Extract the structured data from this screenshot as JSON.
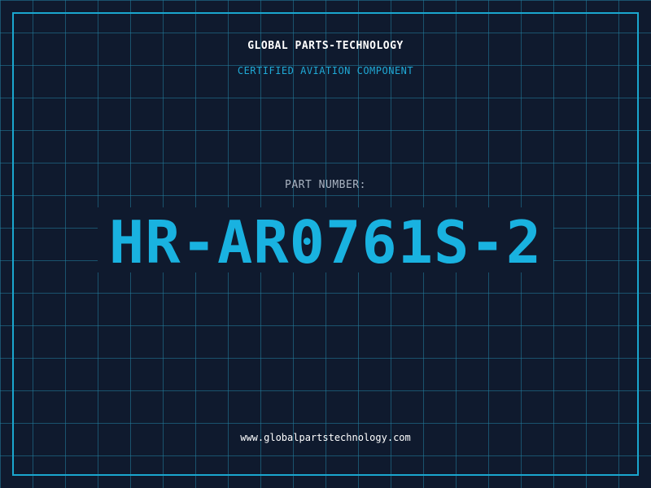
{
  "header": {
    "company_name": "GLOBAL PARTS-TECHNOLOGY",
    "subtitle": "CERTIFIED AVIATION COMPONENT"
  },
  "part": {
    "label": "PART NUMBER:",
    "number": "HR-AR0761S-2"
  },
  "footer": {
    "website": "www.globalpartstechnology.com"
  },
  "colors": {
    "background": "#0f1a2e",
    "grid": "#2280a0",
    "accent": "#19b2e0",
    "text": "#ffffff",
    "label": "#aab4c2"
  }
}
